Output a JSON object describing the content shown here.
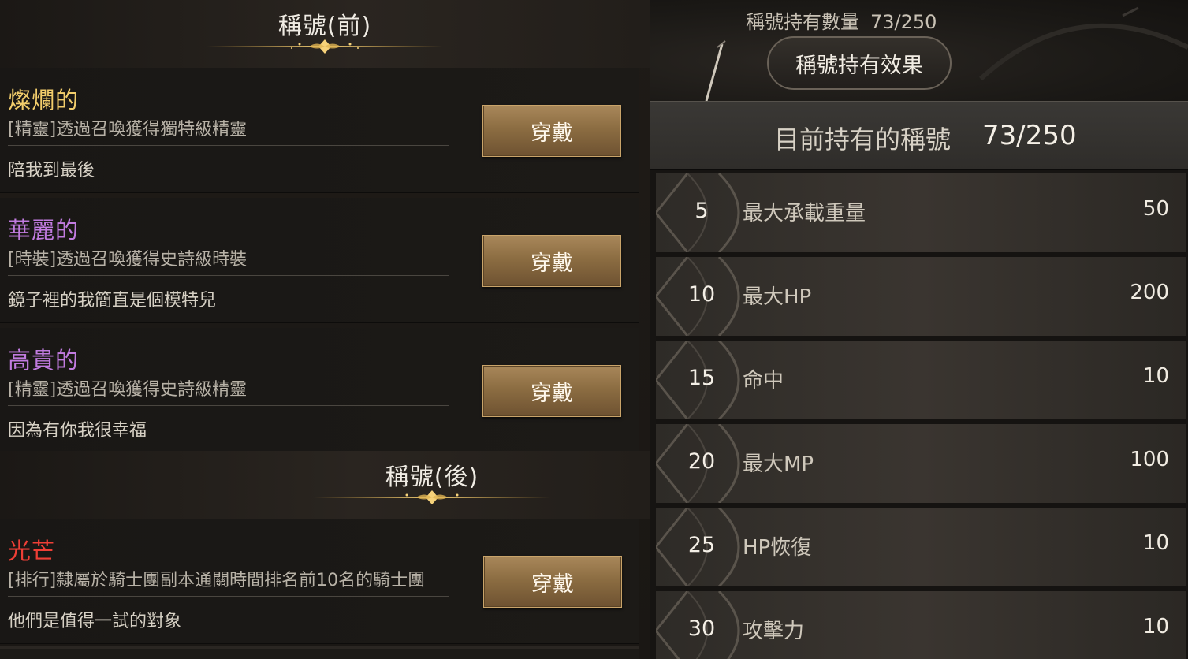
{
  "prefix_section": {
    "title": "稱號(前)"
  },
  "suffix_section": {
    "title": "稱號(後)"
  },
  "equip_label": "穿戴",
  "prefix_titles": [
    {
      "name": "燦爛的",
      "name_color": "#f2cd6b",
      "desc": "[精靈]透過召喚獲得獨特級精靈",
      "flavor": "陪我到最後"
    },
    {
      "name": "華麗的",
      "name_color": "#c17be0",
      "desc": "[時裝]透過召喚獲得史詩級時裝",
      "flavor": "鏡子裡的我簡直是個模特兒"
    },
    {
      "name": "高貴的",
      "name_color": "#c17be0",
      "desc": "[精靈]透過召喚獲得史詩級精靈",
      "flavor": "因為有你我很幸福"
    }
  ],
  "suffix_titles": [
    {
      "name": "光芒",
      "name_color": "#ef3f36",
      "desc": "[排行]隸屬於騎士團副本通關時間排名前10名的騎士團",
      "flavor": "他們是值得一試的對象"
    }
  ],
  "summary": {
    "count_label": "稱號持有數量",
    "count_value": "73/250",
    "effect_button": "稱號持有效果",
    "owned_label": "目前持有的稱號",
    "owned_value": "73/250"
  },
  "rewards": [
    {
      "level": "5",
      "stat": "最大承載重量",
      "value": "50"
    },
    {
      "level": "10",
      "stat": "最大HP",
      "value": "200"
    },
    {
      "level": "15",
      "stat": "命中",
      "value": "10"
    },
    {
      "level": "20",
      "stat": "最大MP",
      "value": "100"
    },
    {
      "level": "25",
      "stat": "HP恢復",
      "value": "10"
    },
    {
      "level": "30",
      "stat": "攻擊力",
      "value": "10"
    }
  ]
}
